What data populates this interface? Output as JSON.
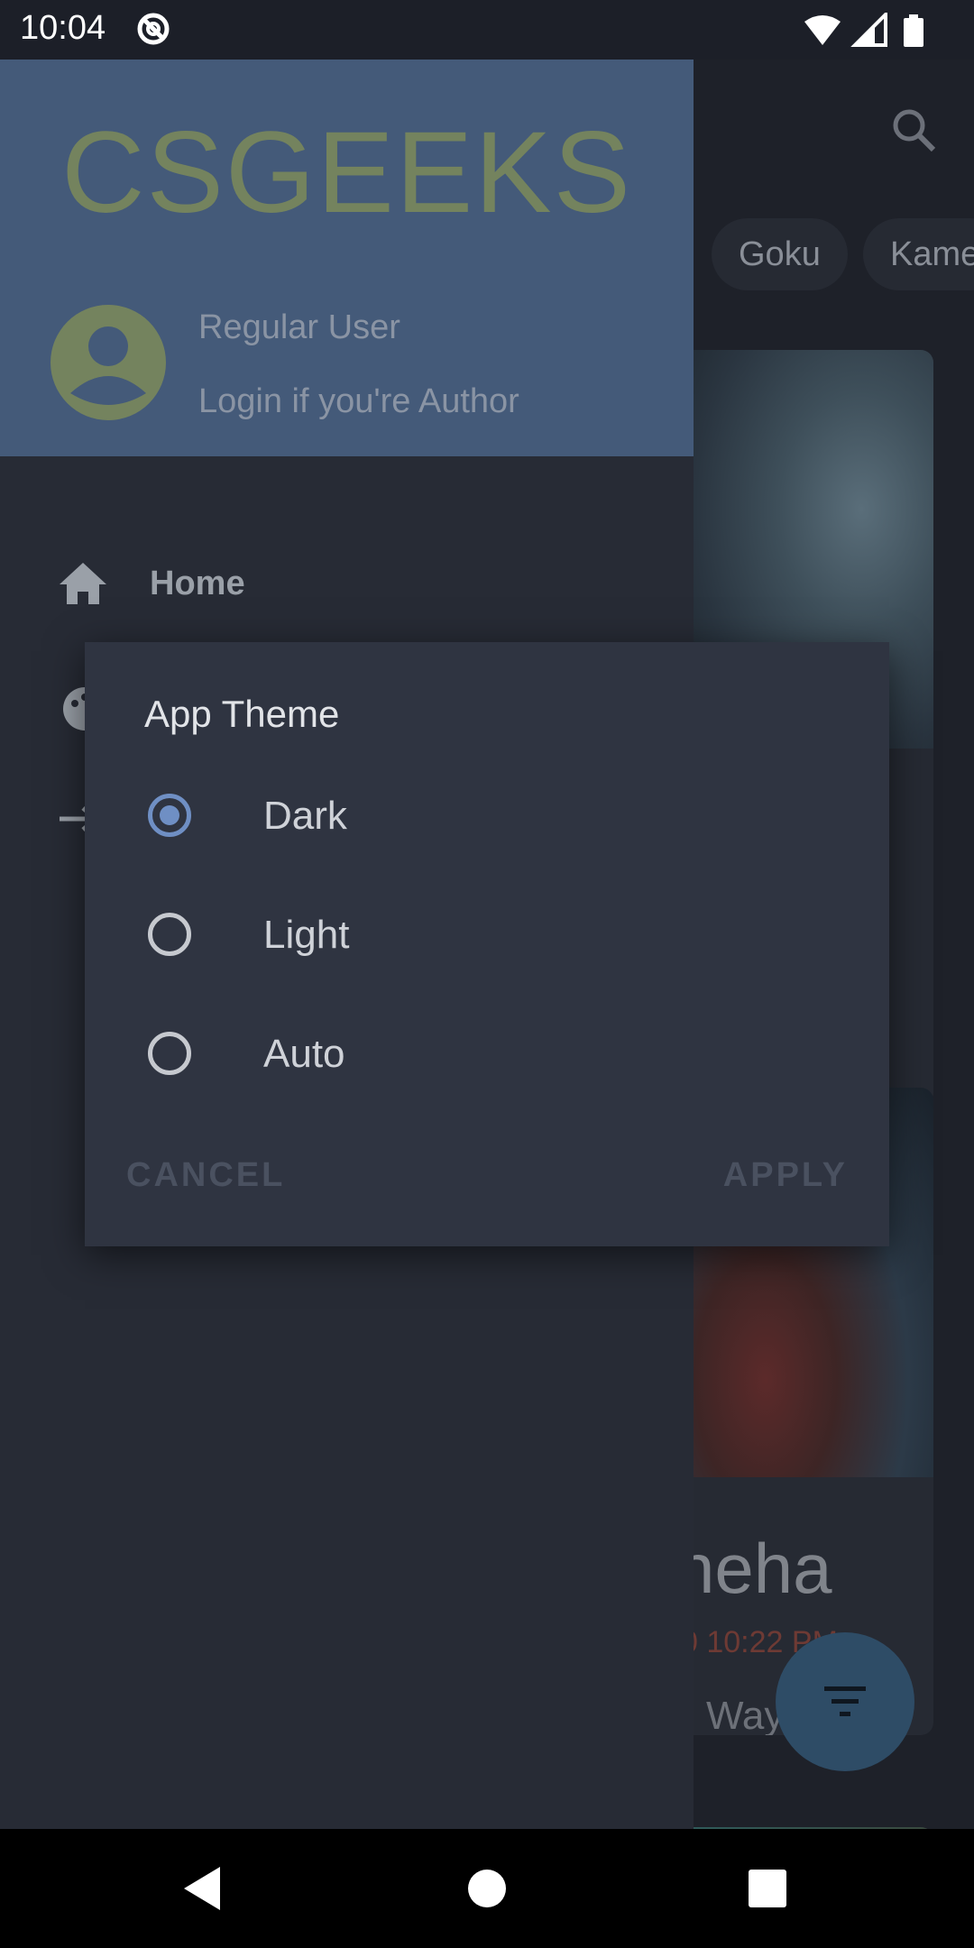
{
  "status_bar": {
    "time": "10:04"
  },
  "drawer": {
    "brand": "CSGEEKS",
    "user_name": "Regular User",
    "user_sub": "Login if you're Author",
    "items": [
      {
        "label": "Home",
        "icon": "home-icon"
      },
      {
        "label": "",
        "icon": "palette-icon"
      },
      {
        "label": "",
        "icon": "logout-icon"
      }
    ]
  },
  "main": {
    "chips": [
      "Goku",
      "Kame"
    ],
    "card2": {
      "title": "neha",
      "date": "0 10:22 PM",
      "subtitle": "Way"
    }
  },
  "dialog": {
    "title": "App Theme",
    "options": [
      {
        "label": "Dark",
        "selected": true
      },
      {
        "label": "Light",
        "selected": false
      },
      {
        "label": "Auto",
        "selected": false
      }
    ],
    "cancel": "CANCEL",
    "apply": "APPLY"
  },
  "colors": {
    "accent": "#6f8fc4",
    "drawer_header": "#445a79",
    "brand": "#74835e"
  }
}
